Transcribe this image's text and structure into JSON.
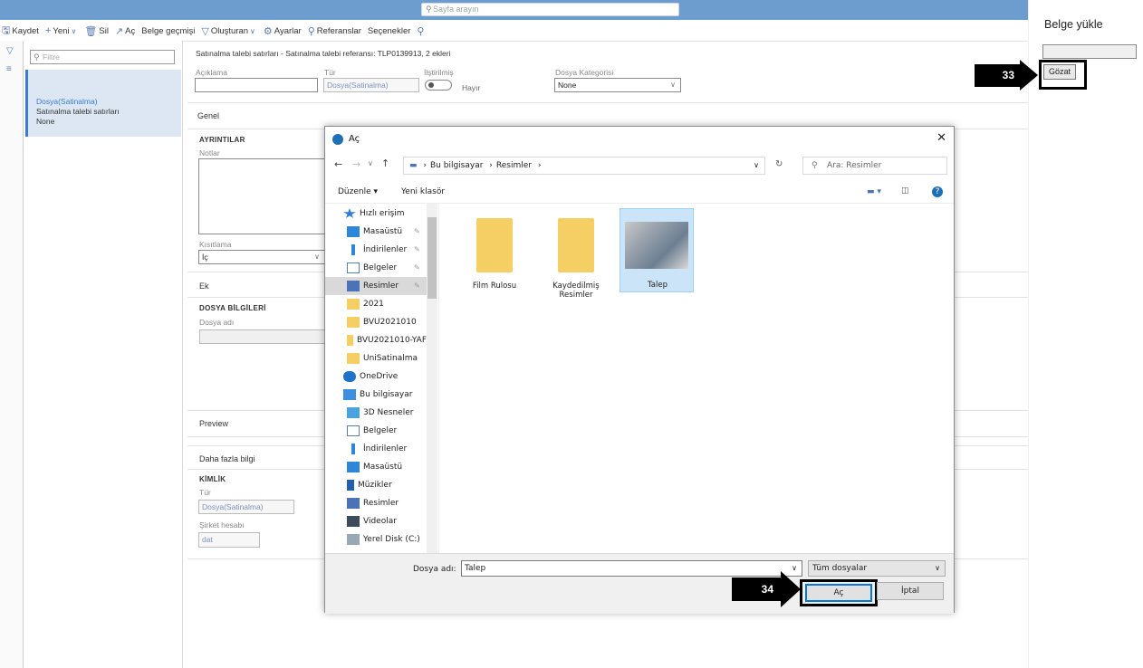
{
  "search": {
    "placeholder": "Sayfa arayın"
  },
  "toolbar": {
    "save": "Kaydet",
    "new": "Yeni",
    "delete": "Sil",
    "open": "Aç",
    "history": "Belge geçmişi",
    "created": "Oluşturan",
    "settings": "Ayarlar",
    "references": "Referanslar",
    "options": "Seçenekler"
  },
  "list": {
    "filter_placeholder": "Filtre",
    "selected": {
      "line1": "Dosya(Satinalma)",
      "line2": "Satınalma talebi satırları",
      "line3": "None"
    }
  },
  "main": {
    "breadcrumb": "Satınalma talebi satırları - Satınalma talebi referansı: TLP0139913, 2 ekleri",
    "fields": {
      "aciklama_label": "Açıklama",
      "tur_label": "Tür",
      "tur_value": "Dosya(Satinalma)",
      "iliskili_label": "İlştirilmiş",
      "iliskili_value": "Hayır",
      "kategori_label": "Dosya Kategorisi",
      "kategori_value": "None"
    },
    "genel": "Genel",
    "ayrintilar": "AYRINTILAR",
    "notlar": "Notlar",
    "kisitlama_label": "Kısıtlama",
    "kisitlama_value": "İç",
    "ek": "Ek",
    "dosya_bilgileri": "DOSYA BİLGİLERİ",
    "dosya_adi": "Dosya adı",
    "preview": "Preview",
    "daha_fazla": "Daha fazla bilgi",
    "kimlik": "KİMLİK",
    "kimlik_tur_label": "Tür",
    "kimlik_tur_value": "Dosya(Satinalma)",
    "sirket_label": "Şirket hesabı",
    "sirket_value": "dat"
  },
  "rightpanel": {
    "title": "Belge yükle",
    "browse": "Gözat"
  },
  "annotations": {
    "a33": "33",
    "a34": "34"
  },
  "dialog": {
    "title": "Aç",
    "path": [
      "Bu bilgisayar",
      "Resimler"
    ],
    "search_placeholder": "Ara: Resimler",
    "organize": "Düzenle",
    "new_folder": "Yeni klasör",
    "tree": [
      {
        "label": "Hızlı erişim",
        "icon": "star-icon",
        "top": true
      },
      {
        "label": "Masaüstü",
        "icon": "desktop-icon",
        "pin": true
      },
      {
        "label": "İndirilenler",
        "icon": "download-icon",
        "pin": true
      },
      {
        "label": "Belgeler",
        "icon": "document-icon",
        "pin": true
      },
      {
        "label": "Resimler",
        "icon": "pictures-icon",
        "pin": true,
        "selected": true
      },
      {
        "label": "2021",
        "icon": "folder-icon"
      },
      {
        "label": "BVU2021010",
        "icon": "folder-icon"
      },
      {
        "label": "BVU2021010-YAF",
        "icon": "folder-icon"
      },
      {
        "label": "UniSatinalma",
        "icon": "folder-icon"
      },
      {
        "label": "OneDrive",
        "icon": "cloud-icon",
        "top": true
      },
      {
        "label": "Bu bilgisayar",
        "icon": "computer-icon",
        "top": true
      },
      {
        "label": "3D Nesneler",
        "icon": "cube-icon"
      },
      {
        "label": "Belgeler",
        "icon": "document-icon"
      },
      {
        "label": "İndirilenler",
        "icon": "download-icon"
      },
      {
        "label": "Masaüstü",
        "icon": "desktop-icon"
      },
      {
        "label": "Müzikler",
        "icon": "music-icon"
      },
      {
        "label": "Resimler",
        "icon": "pictures-icon"
      },
      {
        "label": "Videolar",
        "icon": "video-icon"
      },
      {
        "label": "Yerel Disk (C:)",
        "icon": "disk-icon"
      }
    ],
    "files": [
      {
        "name": "Film Rulosu",
        "type": "folder"
      },
      {
        "name": "Kaydedilmiş Resimler",
        "type": "folder"
      },
      {
        "name": "Talep",
        "type": "image",
        "selected": true
      }
    ],
    "filename_label": "Dosya adı:",
    "filename_value": "Talep",
    "filter_value": "Tüm dosyalar",
    "open_btn": "Aç",
    "cancel_btn": "İptal"
  }
}
